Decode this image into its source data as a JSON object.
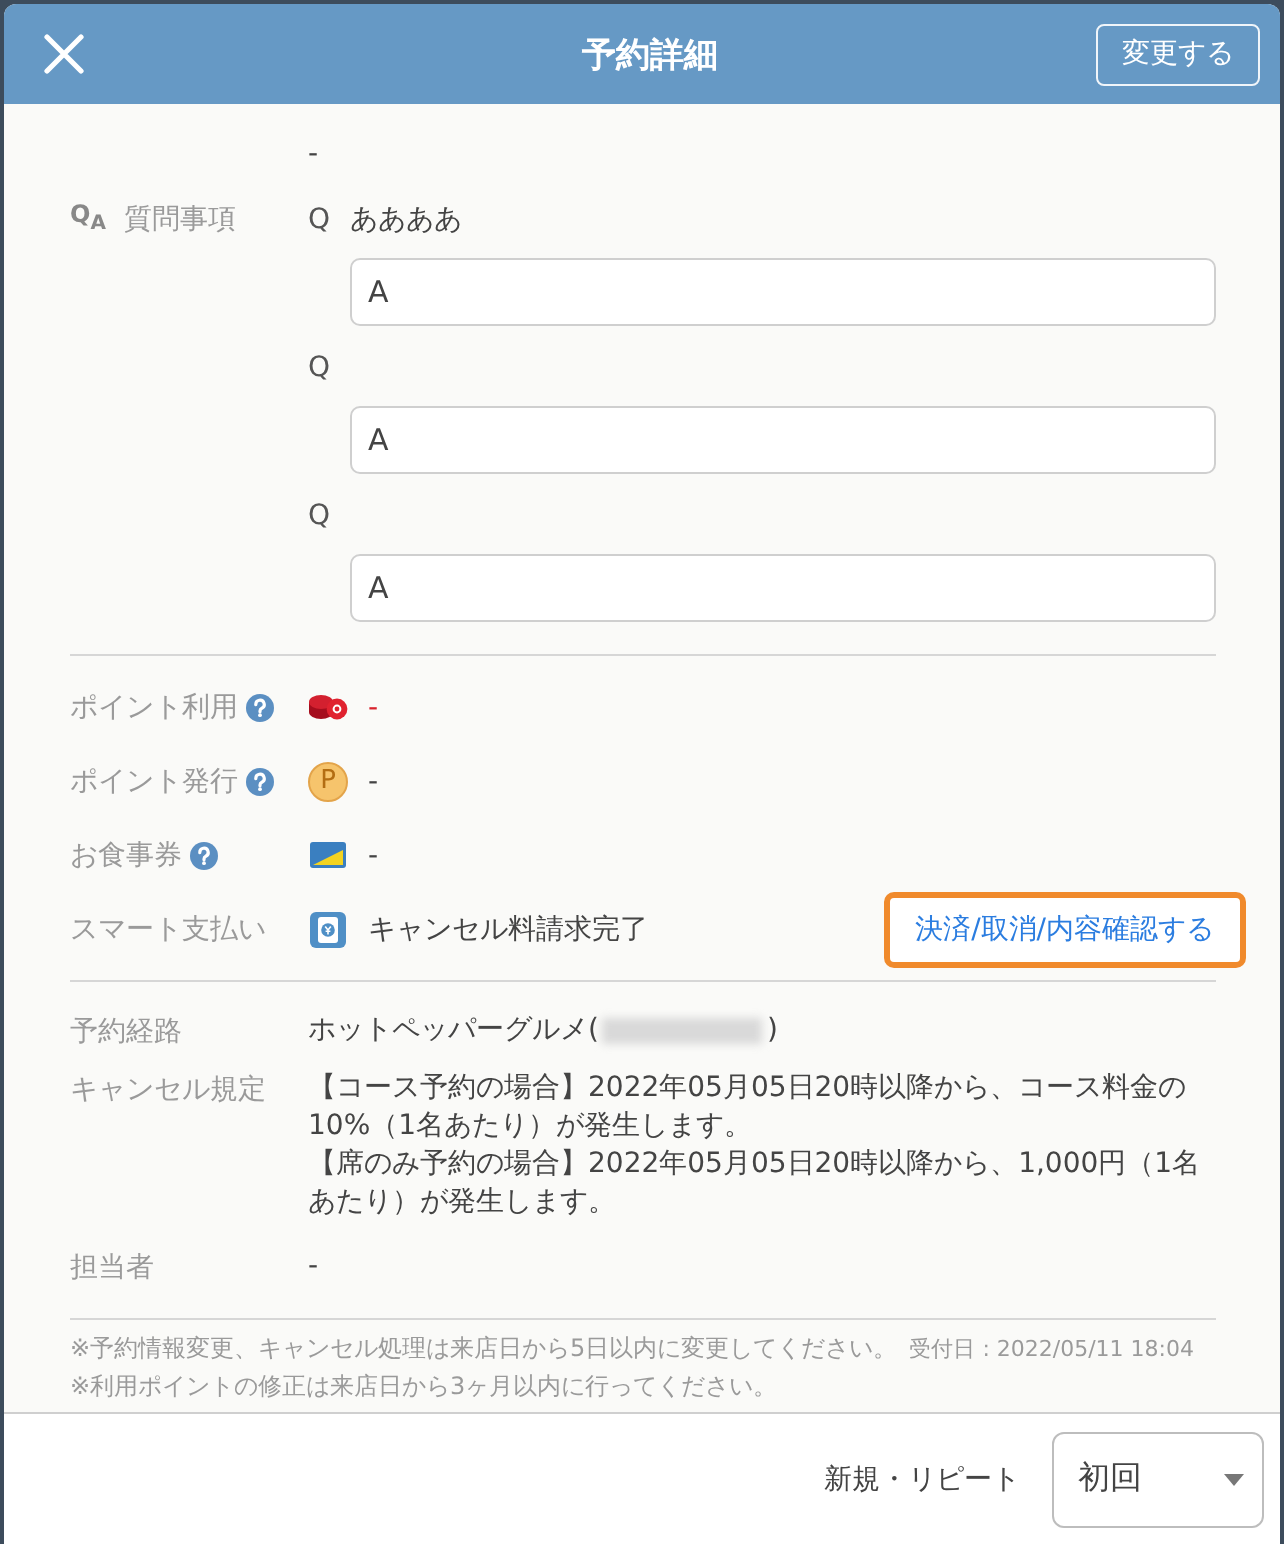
{
  "header": {
    "title": "予約詳細",
    "edit_button": "変更する"
  },
  "memo": {
    "value": "-"
  },
  "questions": {
    "icon": "Q$_{A}$",
    "label": "質問事項",
    "items": [
      {
        "mark": "Q",
        "question": "ああああ",
        "answer": "A"
      },
      {
        "mark": "Q",
        "answer": "A"
      },
      {
        "mark": "Q",
        "answer": "A"
      }
    ]
  },
  "payment_rows": [
    {
      "kind": "points_used",
      "label": "ポイント利用",
      "help": true,
      "value": "-"
    },
    {
      "kind": "points_issued",
      "label": "ポイント発行",
      "help": true,
      "icon_letter": "P",
      "value": "-"
    },
    {
      "kind": "meal_ticket",
      "label": "お食事券",
      "help": true,
      "value": "-"
    },
    {
      "kind": "smart_pay",
      "label": "スマート支払い",
      "help": false,
      "value": "キャンセル料請求完了",
      "action": "決済/取消/内容確認する",
      "action_highlighted": true
    }
  ],
  "details": [
    {
      "kind": "route",
      "label": "予約経路",
      "value": "ホットペッパーグルメ(",
      "redacted": true,
      "value_end": ")"
    },
    {
      "kind": "paragraphs",
      "label": "キャンセル規定",
      "paragraphs": [
        "【コース予約の場合】2022年05月05日20時以降から、コース料金の10%（1名あたり）が発生します。",
        "【席のみ予約の場合】2022年05月05日20時以降から、1,000円（1名あたり）が発生します。"
      ]
    },
    {
      "kind": "text",
      "label": "担当者",
      "value": "-"
    }
  ],
  "notes": [
    {
      "text": "※予約情報変更、キャンセル処理は来店日から5日以内に変更してください。",
      "received": "受付日 : 2022/05/11 18:04"
    },
    {
      "text": "※利用ポイントの修正は来店日から3ヶ月以内に行ってください。"
    }
  ],
  "footer": {
    "label": "新規・リピート",
    "select_value": "初回"
  }
}
